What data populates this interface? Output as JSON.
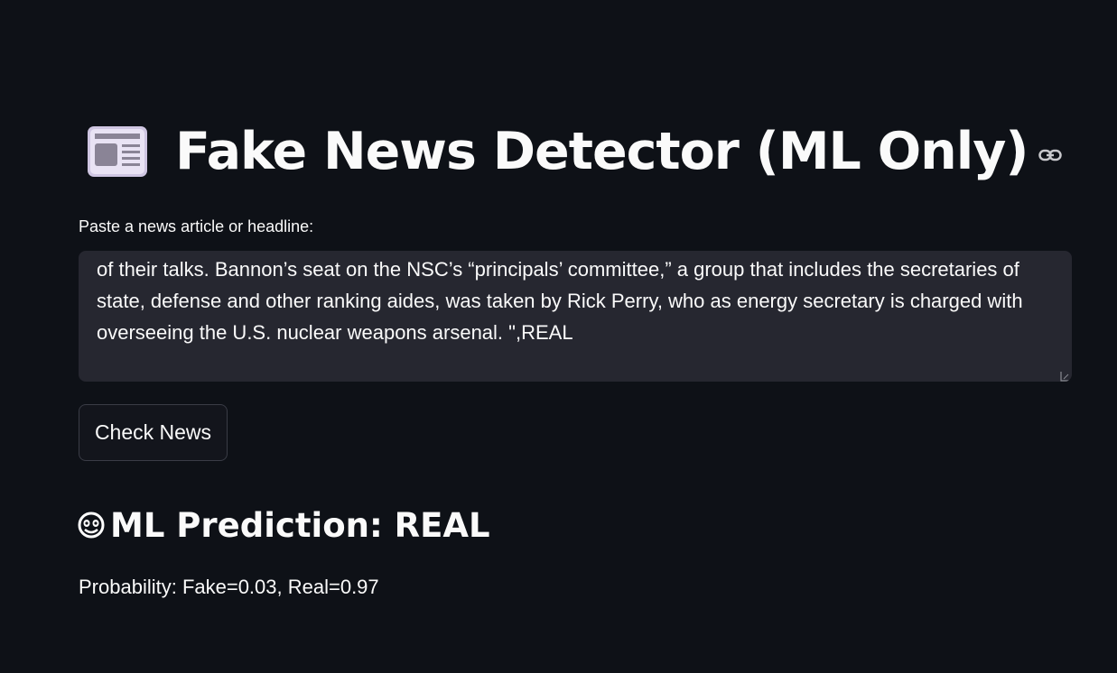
{
  "header": {
    "icon": "newspaper-icon",
    "title": "Fake News Detector (ML Only)",
    "anchor_icon": "link-icon"
  },
  "input": {
    "label": "Paste a news article or headline:",
    "value": "of their talks. Bannon’s seat on the NSC’s “principals’ committee,” a group that includes the secretaries of state, defense and other ranking aides, was taken by Rick Perry, who as energy secretary is charged with overseeing the U.S. nuclear weapons arsenal. \",REAL"
  },
  "actions": {
    "check_label": "Check News"
  },
  "result": {
    "icon": "smiling-face-icon",
    "heading": "ML Prediction: REAL",
    "probability_text": "Probability: Fake=0.03, Real=0.97",
    "fake_probability": 0.03,
    "real_probability": 0.97
  },
  "colors": {
    "background": "#0e1117",
    "input_background": "#262730",
    "text": "#fafafa"
  }
}
